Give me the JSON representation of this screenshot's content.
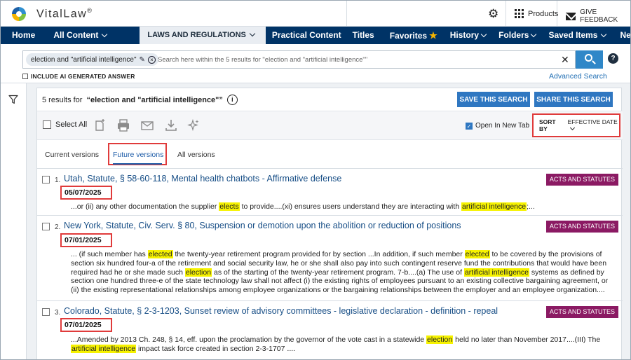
{
  "app": {
    "brand": "VitalLaw",
    "brand_mark": "®"
  },
  "topbar": {
    "products": "Products",
    "feedback": "GIVE FEEDBACK"
  },
  "nav": {
    "items": [
      {
        "label": "Home"
      },
      {
        "label": "All Content"
      },
      {
        "label": "LAWS AND REGULATIONS",
        "active": true
      },
      {
        "label": "Practical Content"
      },
      {
        "label": "Titles"
      },
      {
        "label": "Favorites"
      },
      {
        "label": "History"
      },
      {
        "label": "Folders"
      },
      {
        "label": "Saved Items"
      },
      {
        "label": "News Sign-up"
      }
    ]
  },
  "search": {
    "chip": "election and \"artificial intelligence\"",
    "placeholder": "Search here within the 5 results for \"election and \"artificial intelligence\"\"",
    "ai_label": "INCLUDE AI GENERATED ANSWER",
    "advanced": "Advanced Search"
  },
  "results_header": {
    "count_text": "5 results for",
    "query_text": "“election and \"artificial intelligence\"”",
    "save_search": "SAVE THIS SEARCH",
    "share_search": "SHARE THIS SEARCH"
  },
  "toolbar": {
    "select_all": "Select All",
    "open_new_tab": "Open In New Tab",
    "sort_label": "SORT BY",
    "sort_value": "EFFECTIVE DATE"
  },
  "tabs": [
    {
      "label": "Current versions"
    },
    {
      "label": "Future versions",
      "active": true
    },
    {
      "label": "All versions"
    }
  ],
  "results": [
    {
      "num": "1.",
      "title": "Utah, Statute, § 58-60-118, Mental health chatbots - Affirmative defense",
      "badge": "ACTS AND STATUTES",
      "date": "05/07/2025",
      "snippet": [
        {
          "t": "...or (ii) any other documentation the supplier "
        },
        {
          "t": "elects",
          "hl": true
        },
        {
          "t": " to provide....(xi) ensures users understand they are interacting with "
        },
        {
          "t": "artificial intelligence",
          "hl": true
        },
        {
          "t": ";..."
        }
      ]
    },
    {
      "num": "2.",
      "title": "New York, Statute, Civ. Serv. § 80, Suspension or demotion upon the abolition or reduction of positions",
      "badge": "ACTS AND STATUTES",
      "date": "07/01/2025",
      "snippet": [
        {
          "t": "... (if such member has "
        },
        {
          "t": "elected",
          "hl": true
        },
        {
          "t": " the twenty-year retirement program provided for by section ...In addition, if such member "
        },
        {
          "t": "elected",
          "hl": true
        },
        {
          "t": " to be covered by the provisions of section six hundred four-a of the retirement and social security law, he or she shall also pay into such contingent reserve fund the contributions that would have been required had he or she made such "
        },
        {
          "t": "election",
          "hl": true
        },
        {
          "t": " as of the starting of the twenty-year retirement program. 7-b....(a) The use of "
        },
        {
          "t": "artificial intelligence",
          "hl": true
        },
        {
          "t": " systems as defined by section one hundred three-e of the state technology law shall not affect (i) the existing rights of employees pursuant to an existing collective bargaining agreement, or (ii) the existing representational relationships among employee organizations or the bargaining relationships between the employer and an employee organization...."
        }
      ]
    },
    {
      "num": "3.",
      "title": "Colorado, Statute, § 2-3-1203, Sunset review of advisory committees - legislative declaration - definition - repeal",
      "badge": "ACTS AND STATUTES",
      "date": "07/01/2025",
      "snippet": [
        {
          "t": "...Amended by 2013 Ch. 248, § 14, eff. upon the proclamation by the governor of the vote cast in a statewide "
        },
        {
          "t": "election",
          "hl": true
        },
        {
          "t": " held no later than November 2017....(III) The "
        },
        {
          "t": "artificial intelligence",
          "hl": true
        },
        {
          "t": " impact task force created in section 2-3-1707 ...."
        }
      ]
    }
  ],
  "colors": {
    "nav_bg": "#003366",
    "accent_blue": "#2f77c1",
    "badge": "#8b1a63",
    "highlight": "#f6f200",
    "callout_red": "#e03b3b"
  }
}
